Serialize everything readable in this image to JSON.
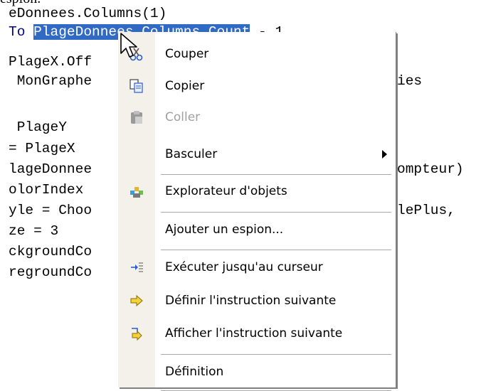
{
  "caption": "espion.",
  "code": {
    "lines": [
      {
        "text": "eDonnees.Columns(1)"
      },
      {
        "prefix": "To ",
        "selected": "PlageDonnees.Columns.Count",
        "suffix": " - 1"
      },
      {
        "text": "PlageX.Off"
      },
      {
        "text": " MonGraphe",
        "tail": "ies"
      },
      {
        "text": ""
      },
      {
        "text": " PlageY"
      },
      {
        "text": "= PlageX"
      },
      {
        "text": "lageDonnee",
        "tail": "ompteur)"
      },
      {
        "text": "olorIndex"
      },
      {
        "text": "yle = Choo",
        "tail": "lePlus,"
      },
      {
        "text": "ze = 3"
      },
      {
        "text": "ckgroundCo"
      },
      {
        "text": "regroundCo"
      }
    ]
  },
  "menu": {
    "items": [
      {
        "label": "Couper",
        "icon": "scissors-icon",
        "enabled": true
      },
      {
        "label": "Copier",
        "icon": "copy-icon",
        "enabled": true
      },
      {
        "label": "Coller",
        "icon": "paste-icon",
        "enabled": false
      },
      {
        "label": "Basculer",
        "icon": "",
        "enabled": true,
        "submenu": true
      },
      {
        "label": "Explorateur d'objets",
        "icon": "object-browser-icon",
        "enabled": true
      },
      {
        "label": "Ajouter un espion...",
        "icon": "",
        "enabled": true
      },
      {
        "label": "Exécuter jusqu'au curseur",
        "icon": "run-to-cursor-icon",
        "enabled": true
      },
      {
        "label": "Définir l'instruction suivante",
        "icon": "set-next-statement-icon",
        "enabled": true
      },
      {
        "label": "Afficher l'instruction suivante",
        "icon": "show-next-statement-icon",
        "enabled": true
      },
      {
        "label": "Définition",
        "icon": "",
        "enabled": true
      }
    ]
  },
  "colors": {
    "selection": "#316ac5",
    "keyword": "#00008b",
    "menu_gutter": "#f3f1ea",
    "disabled_text": "#a0a0a0"
  }
}
